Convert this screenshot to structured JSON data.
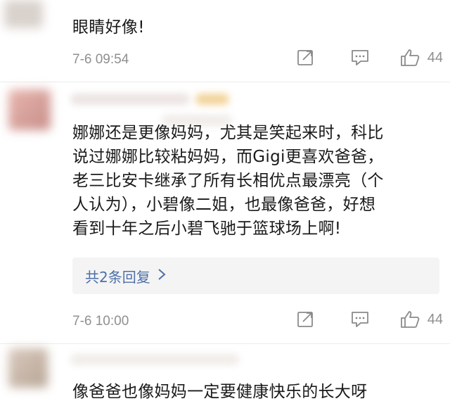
{
  "comments": [
    {
      "text_lines": [
        "眼睛好像!"
      ],
      "time": "7-6 09:54",
      "likes": "44"
    },
    {
      "text_lines": [
        "娜娜还是更像妈妈，尤其是笑起来时，科比",
        "说过娜娜比较粘妈妈，而Gigi更喜欢爸爸，",
        "老三比安卡继承了所有长相优点最漂亮（个",
        "人认为），小碧像二姐，也最像爸爸，好想",
        "看到十年之后小碧飞驰于篮球场上啊!"
      ],
      "replies_label": "共2条回复",
      "time": "7-6 10:00",
      "likes": "44"
    },
    {
      "text_lines": [
        "像爸爸也像妈妈一定要健康快乐的长大呀"
      ]
    }
  ],
  "icons": {
    "share": "share-icon",
    "comment": "comment-icon",
    "like": "thumbs-up-icon",
    "chevron": "chevron-right-icon"
  },
  "colors": {
    "link": "#4d6fa7",
    "meta": "#8f8f8f",
    "reply_bg": "#f4f4f4"
  }
}
